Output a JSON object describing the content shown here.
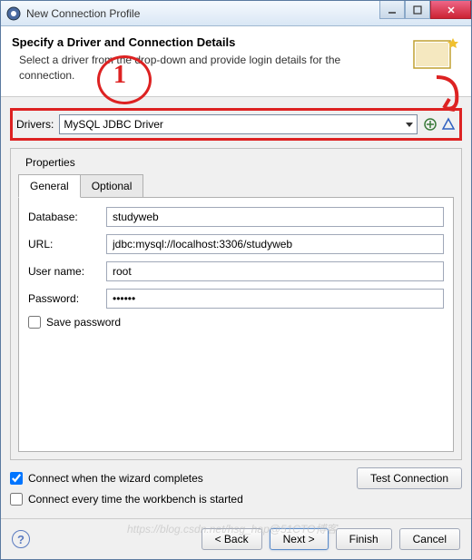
{
  "window": {
    "title": "New Connection Profile"
  },
  "header": {
    "title": "Specify a Driver and Connection Details",
    "subtitle": "Select a driver from the drop-down and provide login details for the connection."
  },
  "drivers": {
    "label": "Drivers:",
    "selected": "MySQL JDBC Driver"
  },
  "properties": {
    "title": "Properties",
    "tabs": {
      "general": "General",
      "optional": "Optional"
    },
    "fields": {
      "database_label": "Database:",
      "database_value": "studyweb",
      "url_label": "URL:",
      "url_value": "jdbc:mysql://localhost:3306/studyweb",
      "username_label": "User name:",
      "username_value": "root",
      "password_label": "Password:",
      "password_value": "••••••",
      "save_password_label": "Save password"
    }
  },
  "options": {
    "connect_on_complete": "Connect when the wizard completes",
    "connect_every_time": "Connect every time the workbench is started",
    "test_connection": "Test Connection"
  },
  "buttons": {
    "back": "< Back",
    "next": "Next >",
    "finish": "Finish",
    "cancel": "Cancel"
  },
  "annotations": {
    "red1": "1"
  },
  "watermark": "https://blog.csdn.net/hsg_hap@51CTO博客"
}
